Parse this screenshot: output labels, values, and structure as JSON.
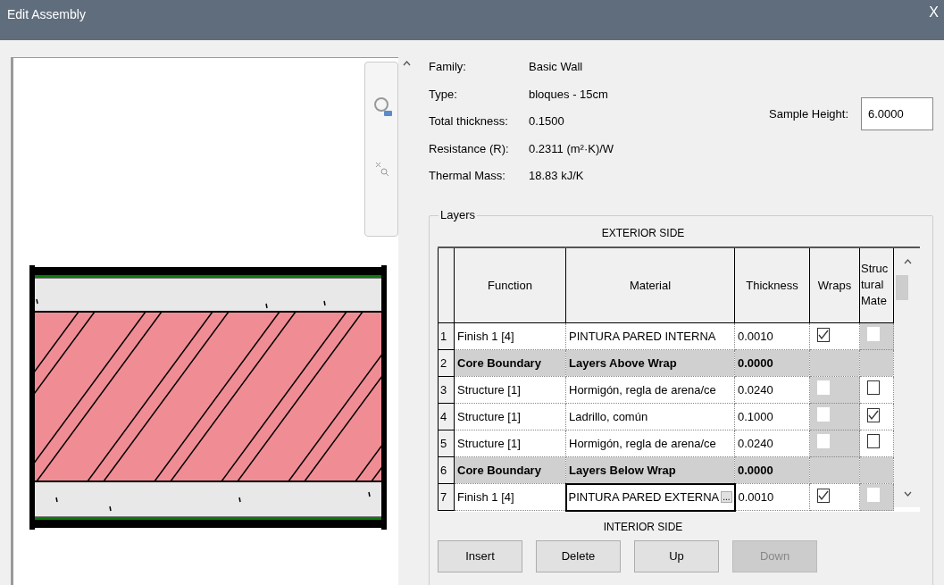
{
  "window": {
    "title": "Edit Assembly",
    "close": "X"
  },
  "properties": [
    {
      "label": "Family:",
      "value": "Basic Wall"
    },
    {
      "label": "Type:",
      "value": "bloques - 15cm"
    },
    {
      "label": "Total thickness:",
      "value": "0.1500"
    },
    {
      "label": "Resistance (R):",
      "value": "0.2311 (m²·K)/W"
    },
    {
      "label": "Thermal Mass:",
      "value": "18.83 kJ/K"
    }
  ],
  "sample_height": {
    "label": "Sample Height:",
    "value": "6.0000"
  },
  "layers": {
    "title": "Layers",
    "top_caption": "EXTERIOR SIDE",
    "bottom_caption": "INTERIOR SIDE",
    "columns": [
      "Function",
      "Material",
      "Thickness",
      "Wraps",
      "Struc tural Mate"
    ],
    "rows": [
      {
        "kind": "layer",
        "number": "1",
        "function": "Finish 1 [4]",
        "material": "PINTURA PARED INTERNA",
        "thickness": "0.0010",
        "wraps": {
          "checked": true,
          "disabled": false
        },
        "structural": {
          "checked": false,
          "disabled": true
        }
      },
      {
        "kind": "boundary",
        "number": "2",
        "function": "Core Boundary",
        "material": "Layers Above Wrap",
        "thickness": "0.0000"
      },
      {
        "kind": "layer",
        "number": "3",
        "function": "Structure [1]",
        "material": "Hormigón, regla de arena/ce",
        "thickness": "0.0240",
        "wraps": {
          "checked": false,
          "disabled": true
        },
        "structural": {
          "checked": false,
          "disabled": false
        }
      },
      {
        "kind": "layer",
        "number": "4",
        "function": "Structure [1]",
        "material": "Ladrillo, común",
        "thickness": "0.1000",
        "wraps": {
          "checked": false,
          "disabled": true
        },
        "structural": {
          "checked": true,
          "disabled": false
        }
      },
      {
        "kind": "layer",
        "number": "5",
        "function": "Structure [1]",
        "material": "Hormigón, regla de arena/ce",
        "thickness": "0.0240",
        "wraps": {
          "checked": false,
          "disabled": true
        },
        "structural": {
          "checked": false,
          "disabled": false
        }
      },
      {
        "kind": "boundary",
        "number": "6",
        "function": "Core Boundary",
        "material": "Layers Below Wrap",
        "thickness": "0.0000"
      },
      {
        "kind": "layer",
        "number": "7",
        "function": "Finish 1 [4]",
        "material": "PINTURA PARED EXTERNA",
        "browse": "...",
        "thickness": "0.0010",
        "wraps": {
          "checked": true,
          "disabled": false
        },
        "structural": {
          "checked": false,
          "disabled": true
        }
      }
    ],
    "buttons": [
      {
        "label": "Insert",
        "disabled": false
      },
      {
        "label": "Delete",
        "disabled": false
      },
      {
        "label": "Up",
        "disabled": false
      },
      {
        "label": "Down",
        "disabled": true
      }
    ]
  }
}
